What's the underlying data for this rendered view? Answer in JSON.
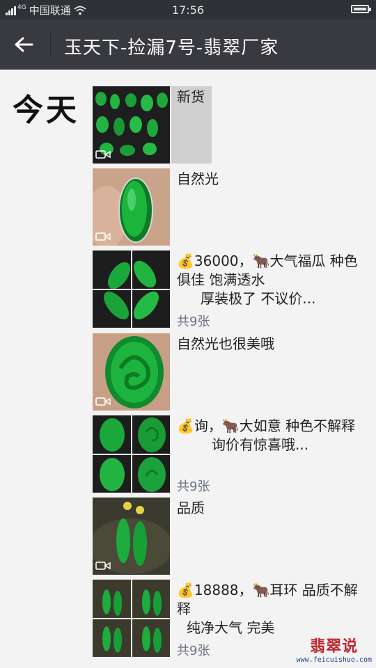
{
  "status_bar": {
    "carrier": "中国联通",
    "time": "17:56",
    "network": "4G"
  },
  "nav": {
    "title": "玉天下-捡漏7号-翡翠厂家",
    "back_icon": "arrow-left-icon"
  },
  "day_label": "今天",
  "posts": [
    {
      "text": "新货",
      "type": "video"
    },
    {
      "text": "自然光",
      "type": "video"
    },
    {
      "line1": "💰36000，🐂大气福瓜  种色俱佳 饱满透水",
      "line2": "厚装极了 不议价...",
      "count": "共9张",
      "type": "album"
    },
    {
      "text": "自然光也很美哦",
      "type": "video"
    },
    {
      "line1": "💰询，🐂大如意  种色不解释",
      "line2": "询价有惊喜哦...",
      "count": "共9张",
      "type": "album"
    },
    {
      "text": "品质",
      "type": "video"
    },
    {
      "line1": "💰18888，🐂耳环 品质不解释",
      "line2": "纯净大气 完美",
      "count": "共9张",
      "type": "album"
    }
  ],
  "watermark": {
    "main": "翡翠说",
    "sub": "www.feicuishuo.com"
  },
  "colors": {
    "jade": "#1faa3a",
    "dark": "#393a3f",
    "status": "#2e3135"
  }
}
